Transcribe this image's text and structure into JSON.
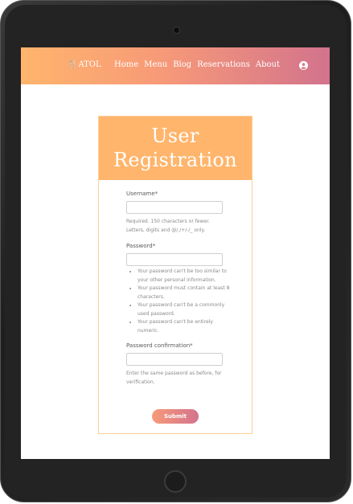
{
  "navbar": {
    "brand": "ATOL",
    "links": [
      "Home",
      "Menu",
      "Blog",
      "Reservations",
      "About"
    ],
    "account_icon": "user-circle-icon",
    "gradient": [
      "#ffb56c",
      "#d3738d"
    ]
  },
  "card": {
    "title_line1": "User",
    "title_line2": "Registration",
    "header_color": "#ffb56c"
  },
  "form": {
    "username": {
      "label": "Username*",
      "value": "",
      "help_line1": "Required. 150 characters or fewer.",
      "help_line2": "Letters, digits and @/./+/-/_ only."
    },
    "password": {
      "label": "Password*",
      "value": "",
      "rules": [
        "Your password can't be too similar to your other personal information.",
        "Your password must contain at least 8 characters.",
        "Your password can't be a commonly used password.",
        "Your password can't be entirely numeric."
      ]
    },
    "password_confirmation": {
      "label": "Password confirmation*",
      "value": "",
      "help": "Enter the same password as before, for verification."
    },
    "submit_label": "Submit"
  }
}
